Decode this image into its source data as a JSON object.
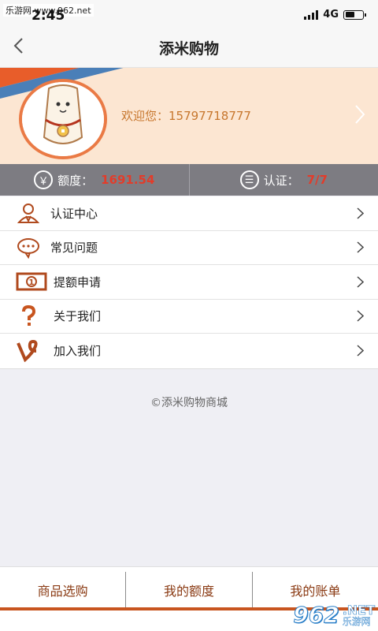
{
  "watermark": "乐游网 www.962.net",
  "status": {
    "time": "2:45",
    "network": "4G"
  },
  "nav": {
    "title": "添米购物"
  },
  "profile": {
    "welcome": "欢迎您：15797718777"
  },
  "stats": {
    "quota": {
      "icon": "yen-icon",
      "glyph": "￥",
      "label": "额度：",
      "value": "1691.54"
    },
    "auth": {
      "icon": "list-icon",
      "glyph": "☰",
      "label": "认证：",
      "value": "7/7"
    }
  },
  "menu": [
    {
      "icon": "user-icon",
      "label": "认证中心"
    },
    {
      "icon": "chat-icon",
      "label": "常见问题"
    },
    {
      "icon": "money-icon",
      "label": "提额申请"
    },
    {
      "icon": "question-icon",
      "label": "关于我们"
    },
    {
      "icon": "vine-icon",
      "label": "加入我们"
    }
  ],
  "copyright": "©添米购物商城",
  "tabs": [
    "商品选购",
    "我的额度",
    "我的账单"
  ],
  "logo": {
    "number": "962",
    "net": ".NET",
    "cn": "乐游网"
  },
  "colors": {
    "accent": "#c8551f",
    "value_red": "#e23c2a",
    "stats_bg": "#7d7c82",
    "welcome": "#c7772e"
  }
}
